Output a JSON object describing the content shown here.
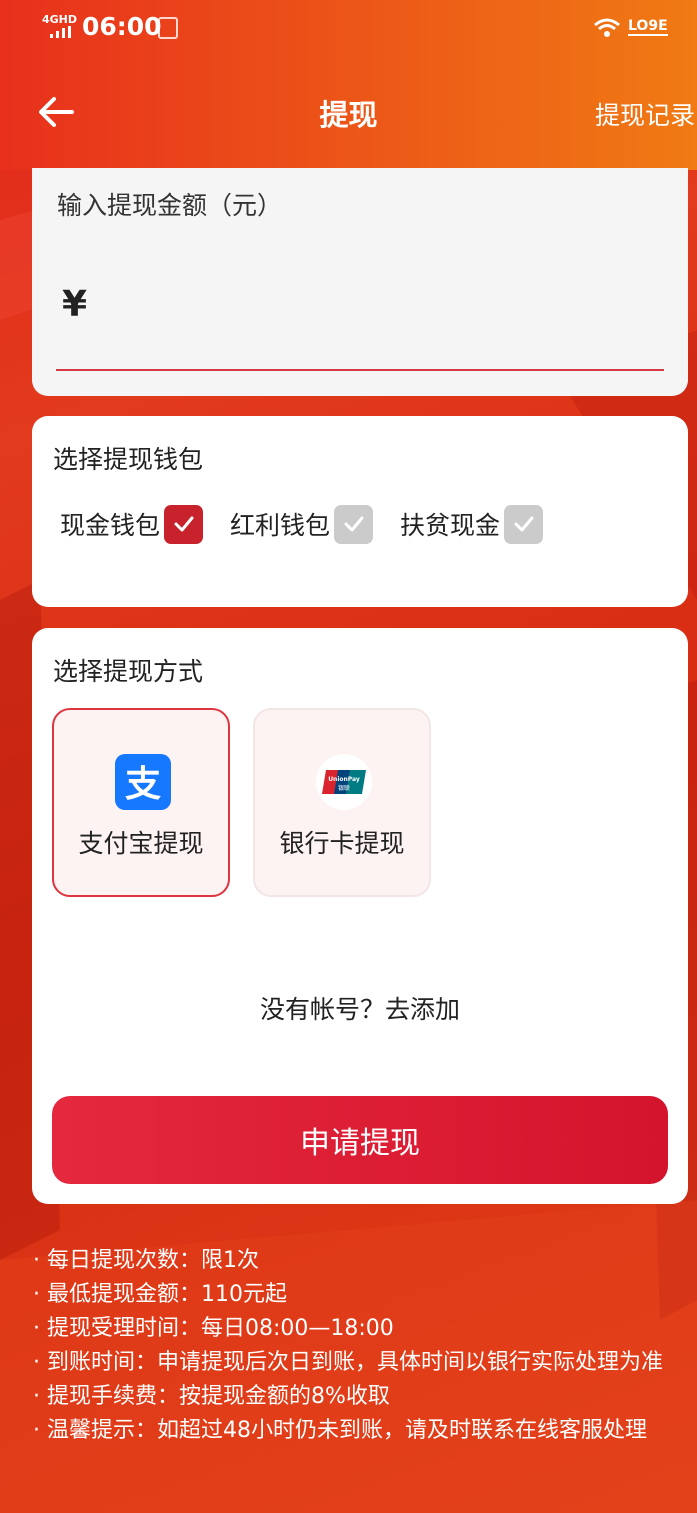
{
  "status_bar": {
    "network": "4GHD",
    "time": "06:00",
    "carrier": "LO9E"
  },
  "nav": {
    "title": "提现",
    "record_label": "提现记录"
  },
  "amount": {
    "label": "输入提现金额（元）",
    "currency_symbol": "¥",
    "value": ""
  },
  "wallet": {
    "title": "选择提现钱包",
    "options": [
      {
        "label": "现金钱包",
        "checked": true
      },
      {
        "label": "红利钱包",
        "checked": false
      },
      {
        "label": "扶贫现金",
        "checked": false
      }
    ]
  },
  "method": {
    "title": "选择提现方式",
    "options": [
      {
        "label": "支付宝提现",
        "icon": "alipay-icon",
        "selected": true
      },
      {
        "label": "银行卡提现",
        "icon": "unionpay-icon",
        "selected": false
      }
    ],
    "no_account": "没有帐号？去添加",
    "submit_label": "申请提现"
  },
  "notes": [
    "· 每日提现次数：限1次",
    "· 最低提现金额：110元起",
    "· 提现受理时间：每日08:00—18:00",
    "· 到账时间：申请提现后次日到账，具体时间以银行实际处理为准",
    "· 提现手续费：按提现金额的8%收取",
    "· 温馨提示：如超过48小时仍未到账，请及时联系在线客服处理"
  ],
  "colors": {
    "brand_red": "#d4142c",
    "checked": "#c8232c",
    "unchecked": "#cbcbcb",
    "alipay_blue": "#1677ff"
  }
}
